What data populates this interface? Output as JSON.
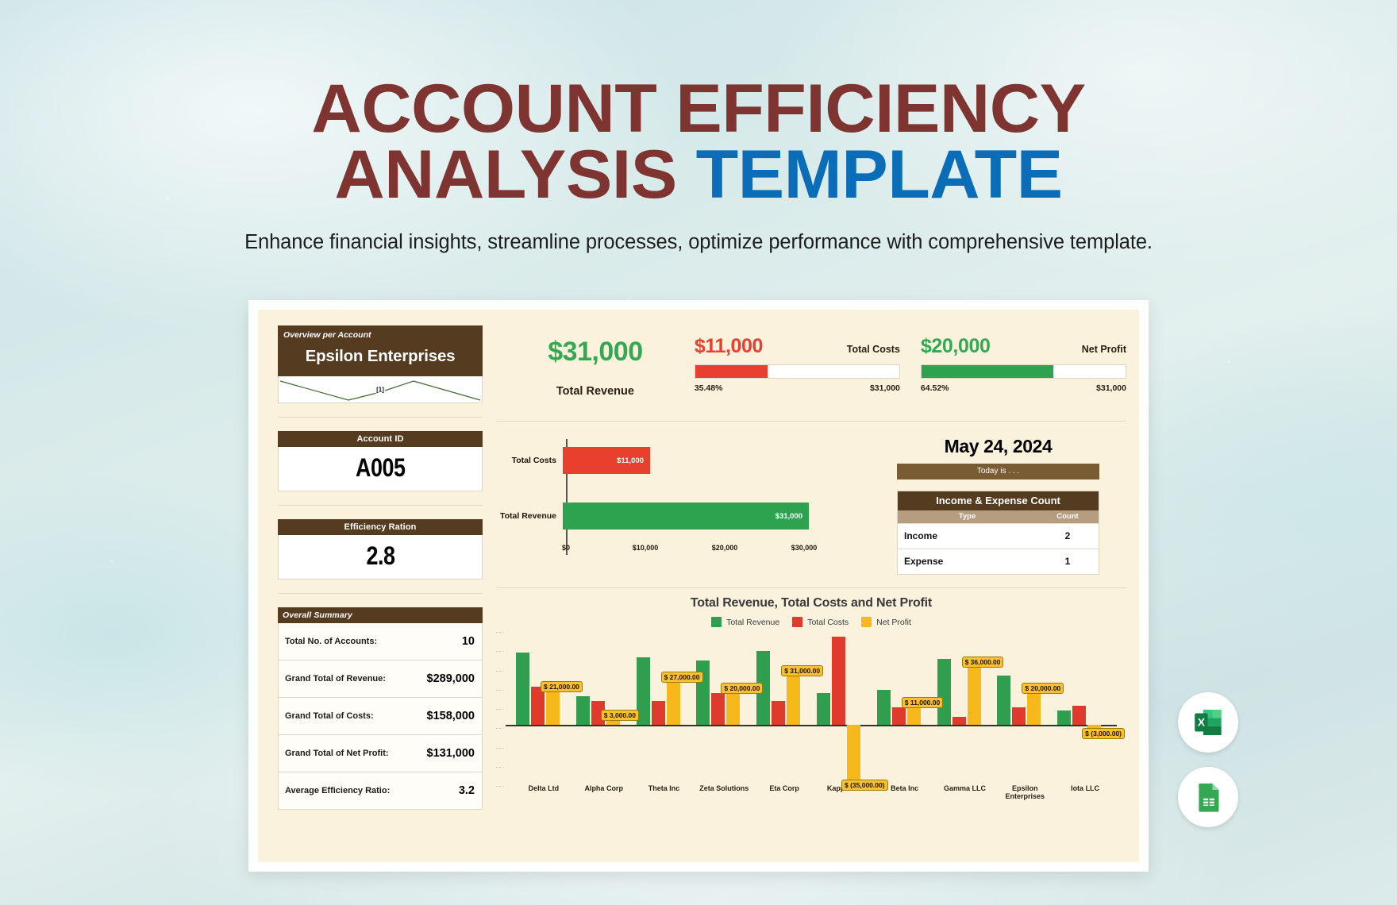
{
  "header": {
    "title_line1": "ACCOUNT EFFICIENCY",
    "title_line2_main": "ANALYSIS ",
    "title_line2_accent": "TEMPLATE",
    "subtitle": "Enhance financial insights, streamline processes, optimize performance with comprehensive template."
  },
  "colors": {
    "brand_dark": "#7e3431",
    "brand_blue": "#0b6cb8",
    "header_brown": "#553b1f",
    "sub_brown": "#b79d80",
    "green": "#2ea34f",
    "red": "#e8402f",
    "yellow": "#f7b81b",
    "sheet_bg": "#fbf2de"
  },
  "overview": {
    "label": "Overview per Account",
    "account_name": "Epsilon Enterprises",
    "sparkline_point_label": "[1]"
  },
  "account_id": {
    "label": "Account ID",
    "value": "A005"
  },
  "efficiency": {
    "label": "Efficiency Ration",
    "value": "2.8"
  },
  "summary": {
    "title": "Overall Summary",
    "rows": [
      {
        "key": "Total No. of Accounts:",
        "value": "10"
      },
      {
        "key": "Grand Total of Revenue:",
        "value": "$289,000"
      },
      {
        "key": "Grand Total of Costs:",
        "value": "$158,000"
      },
      {
        "key": "Grand Total of Net Profit:",
        "value": "$131,000"
      },
      {
        "key": "Average Efficiency Ratio:",
        "value": "3.2"
      }
    ]
  },
  "kpis": {
    "revenue": {
      "amount": "$31,000",
      "caption": "Total Revenue"
    },
    "costs": {
      "amount": "$11,000",
      "caption": "Total Costs",
      "percent_label": "35.48%",
      "percent_value": 35.48,
      "total_label": "$31,000"
    },
    "net_profit": {
      "amount": "$20,000",
      "caption": "Net Profit",
      "percent_label": "64.52%",
      "percent_value": 64.52,
      "total_label": "$31,000"
    }
  },
  "date_block": {
    "date": "May 24, 2024",
    "today_label": "Today is . . ."
  },
  "count_table": {
    "title": "Income & Expense Count",
    "columns": [
      "Type",
      "Count"
    ],
    "rows": [
      {
        "type": "Income",
        "count": "2"
      },
      {
        "type": "Expense",
        "count": "1"
      }
    ]
  },
  "badges": {
    "excel": "excel-icon",
    "sheets": "google-sheets-icon"
  },
  "chart_data": [
    {
      "id": "hbar",
      "type": "bar",
      "orientation": "horizontal",
      "title": "",
      "categories": [
        "Total Costs",
        "Total Revenue"
      ],
      "values": [
        11000,
        31000
      ],
      "value_labels": [
        "$11,000",
        "$31,000"
      ],
      "colors": [
        "#e8402f",
        "#2ea34f"
      ],
      "xlabel": "",
      "ylabel": "",
      "xlim": [
        0,
        33000
      ],
      "xticks": [
        0,
        10000,
        20000,
        30000
      ],
      "xtick_labels": [
        "$0",
        "$10,000",
        "$20,000",
        "$30,000"
      ],
      "grid": false,
      "legend": "none"
    },
    {
      "id": "grouped",
      "type": "bar",
      "orientation": "vertical",
      "title": "Total Revenue, Total Costs and Net Profit",
      "categories": [
        "Delta Ltd",
        "Alpha Corp",
        "Theta Inc",
        "Zeta Solutions",
        "Eta Corp",
        "Kappa Ltd",
        "Beta Inc",
        "Gamma LLC",
        "Epsilon Enterprises",
        "Iota LLC"
      ],
      "series": [
        {
          "name": "Total Revenue",
          "color": "#2f9e4f",
          "values": [
            45000,
            18000,
            42000,
            40000,
            46000,
            20000,
            22000,
            41000,
            31000,
            9000
          ]
        },
        {
          "name": "Total Costs",
          "color": "#e03a2c",
          "values": [
            24000,
            15000,
            15000,
            20000,
            15000,
            55000,
            11000,
            5000,
            11000,
            12000
          ]
        },
        {
          "name": "Net Profit",
          "color": "#f7b81b",
          "values": [
            21000,
            3000,
            27000,
            20000,
            31000,
            -35000,
            11000,
            36000,
            20000,
            -3000
          ]
        }
      ],
      "data_labels": [
        "$ 21,000.00",
        "$ 3,000.00",
        "$ 27,000.00",
        "$ 20,000.00",
        "$ 31,000.00",
        "$ (35,000.00)",
        "$ 11,000.00",
        "$ 36,000.00",
        "$ 20,000.00",
        "$ (3,000.00)"
      ],
      "legend": "top",
      "legend_entries": [
        "Total Revenue",
        "Total Costs",
        "Net Profit"
      ],
      "xlabel": "",
      "ylabel": "",
      "grid": false
    }
  ]
}
